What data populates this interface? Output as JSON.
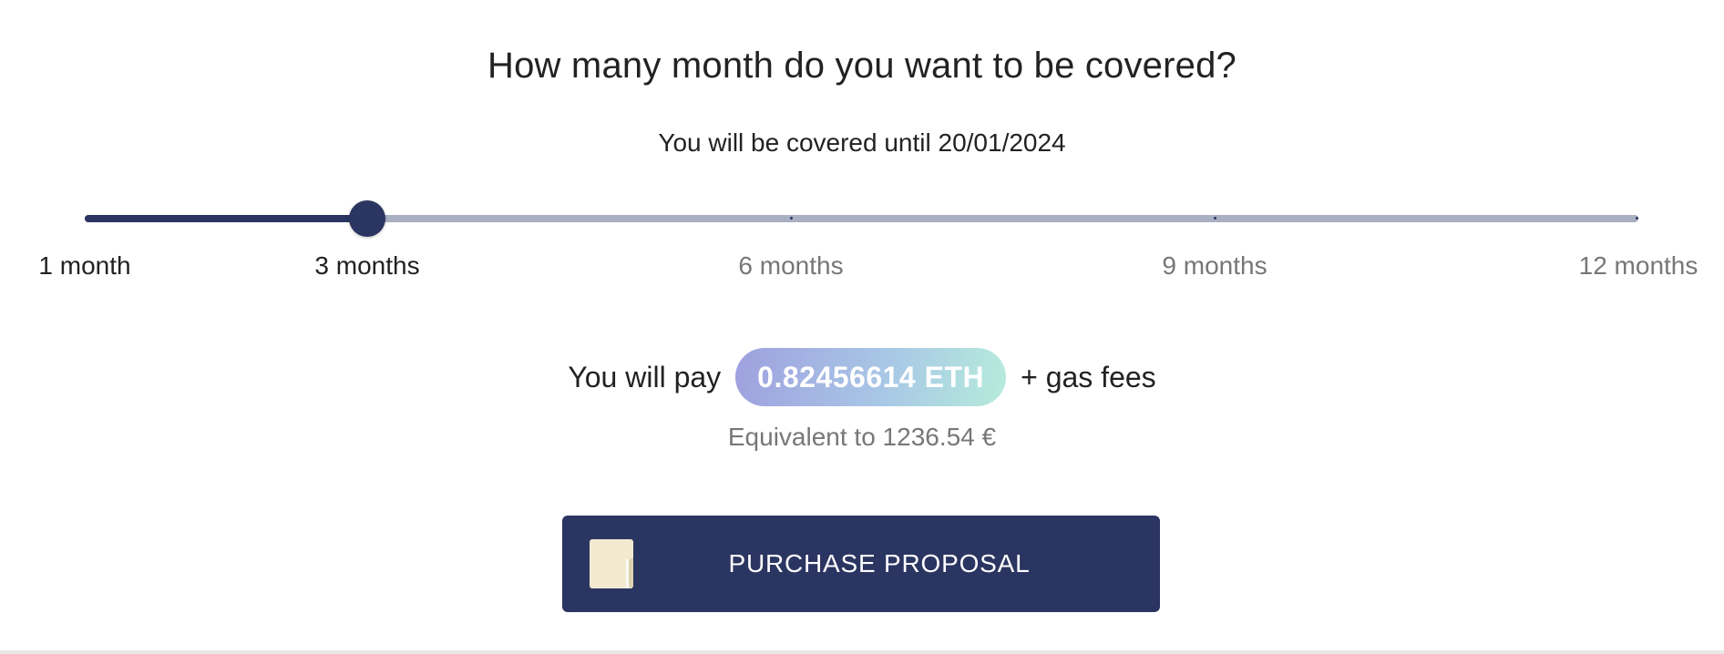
{
  "header": {
    "title": "How many month do you want to be covered?",
    "covered_until": "You will be covered until 20/01/2024"
  },
  "slider": {
    "min": 1,
    "max": 12,
    "value": 3,
    "marks": [
      {
        "value": 1,
        "label": "1 month"
      },
      {
        "value": 3,
        "label": "3 months"
      },
      {
        "value": 6,
        "label": "6 months"
      },
      {
        "value": 9,
        "label": "9 months"
      },
      {
        "value": 12,
        "label": "12 months"
      }
    ],
    "colors": {
      "active": "#2b3561",
      "inactive": "#a9b0c2"
    }
  },
  "payment": {
    "prefix": "You will pay",
    "amount": "0.82456614 ETH",
    "suffix": "+ gas fees",
    "equivalent": "Equivalent to 1236.54 €"
  },
  "purchase_button": {
    "label": "PURCHASE PROPOSAL",
    "icon": "document-icon",
    "color": "#2b3561"
  }
}
